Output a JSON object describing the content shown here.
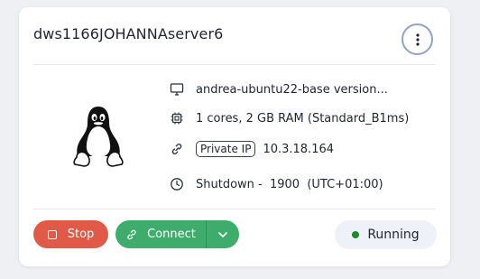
{
  "card": {
    "title": "dws1166JOHANNAserver6",
    "os_icon": "linux-tux-icon",
    "details": {
      "image": "andrea-ubuntu22-base version...",
      "specs": "1 cores, 2 GB RAM (Standard_B1ms)",
      "ip_label": "Private IP",
      "ip_value": "10.3.18.164",
      "shutdown": "Shutdown -  1900  (UTC+01:00)"
    },
    "actions": {
      "stop_label": "Stop",
      "connect_label": "Connect"
    },
    "status": {
      "label": "Running",
      "color": "#1a8a2a"
    }
  },
  "colors": {
    "stop_bg": "#e05a47",
    "connect_bg": "#3eac6b",
    "menu_border": "#8fa3c4"
  }
}
